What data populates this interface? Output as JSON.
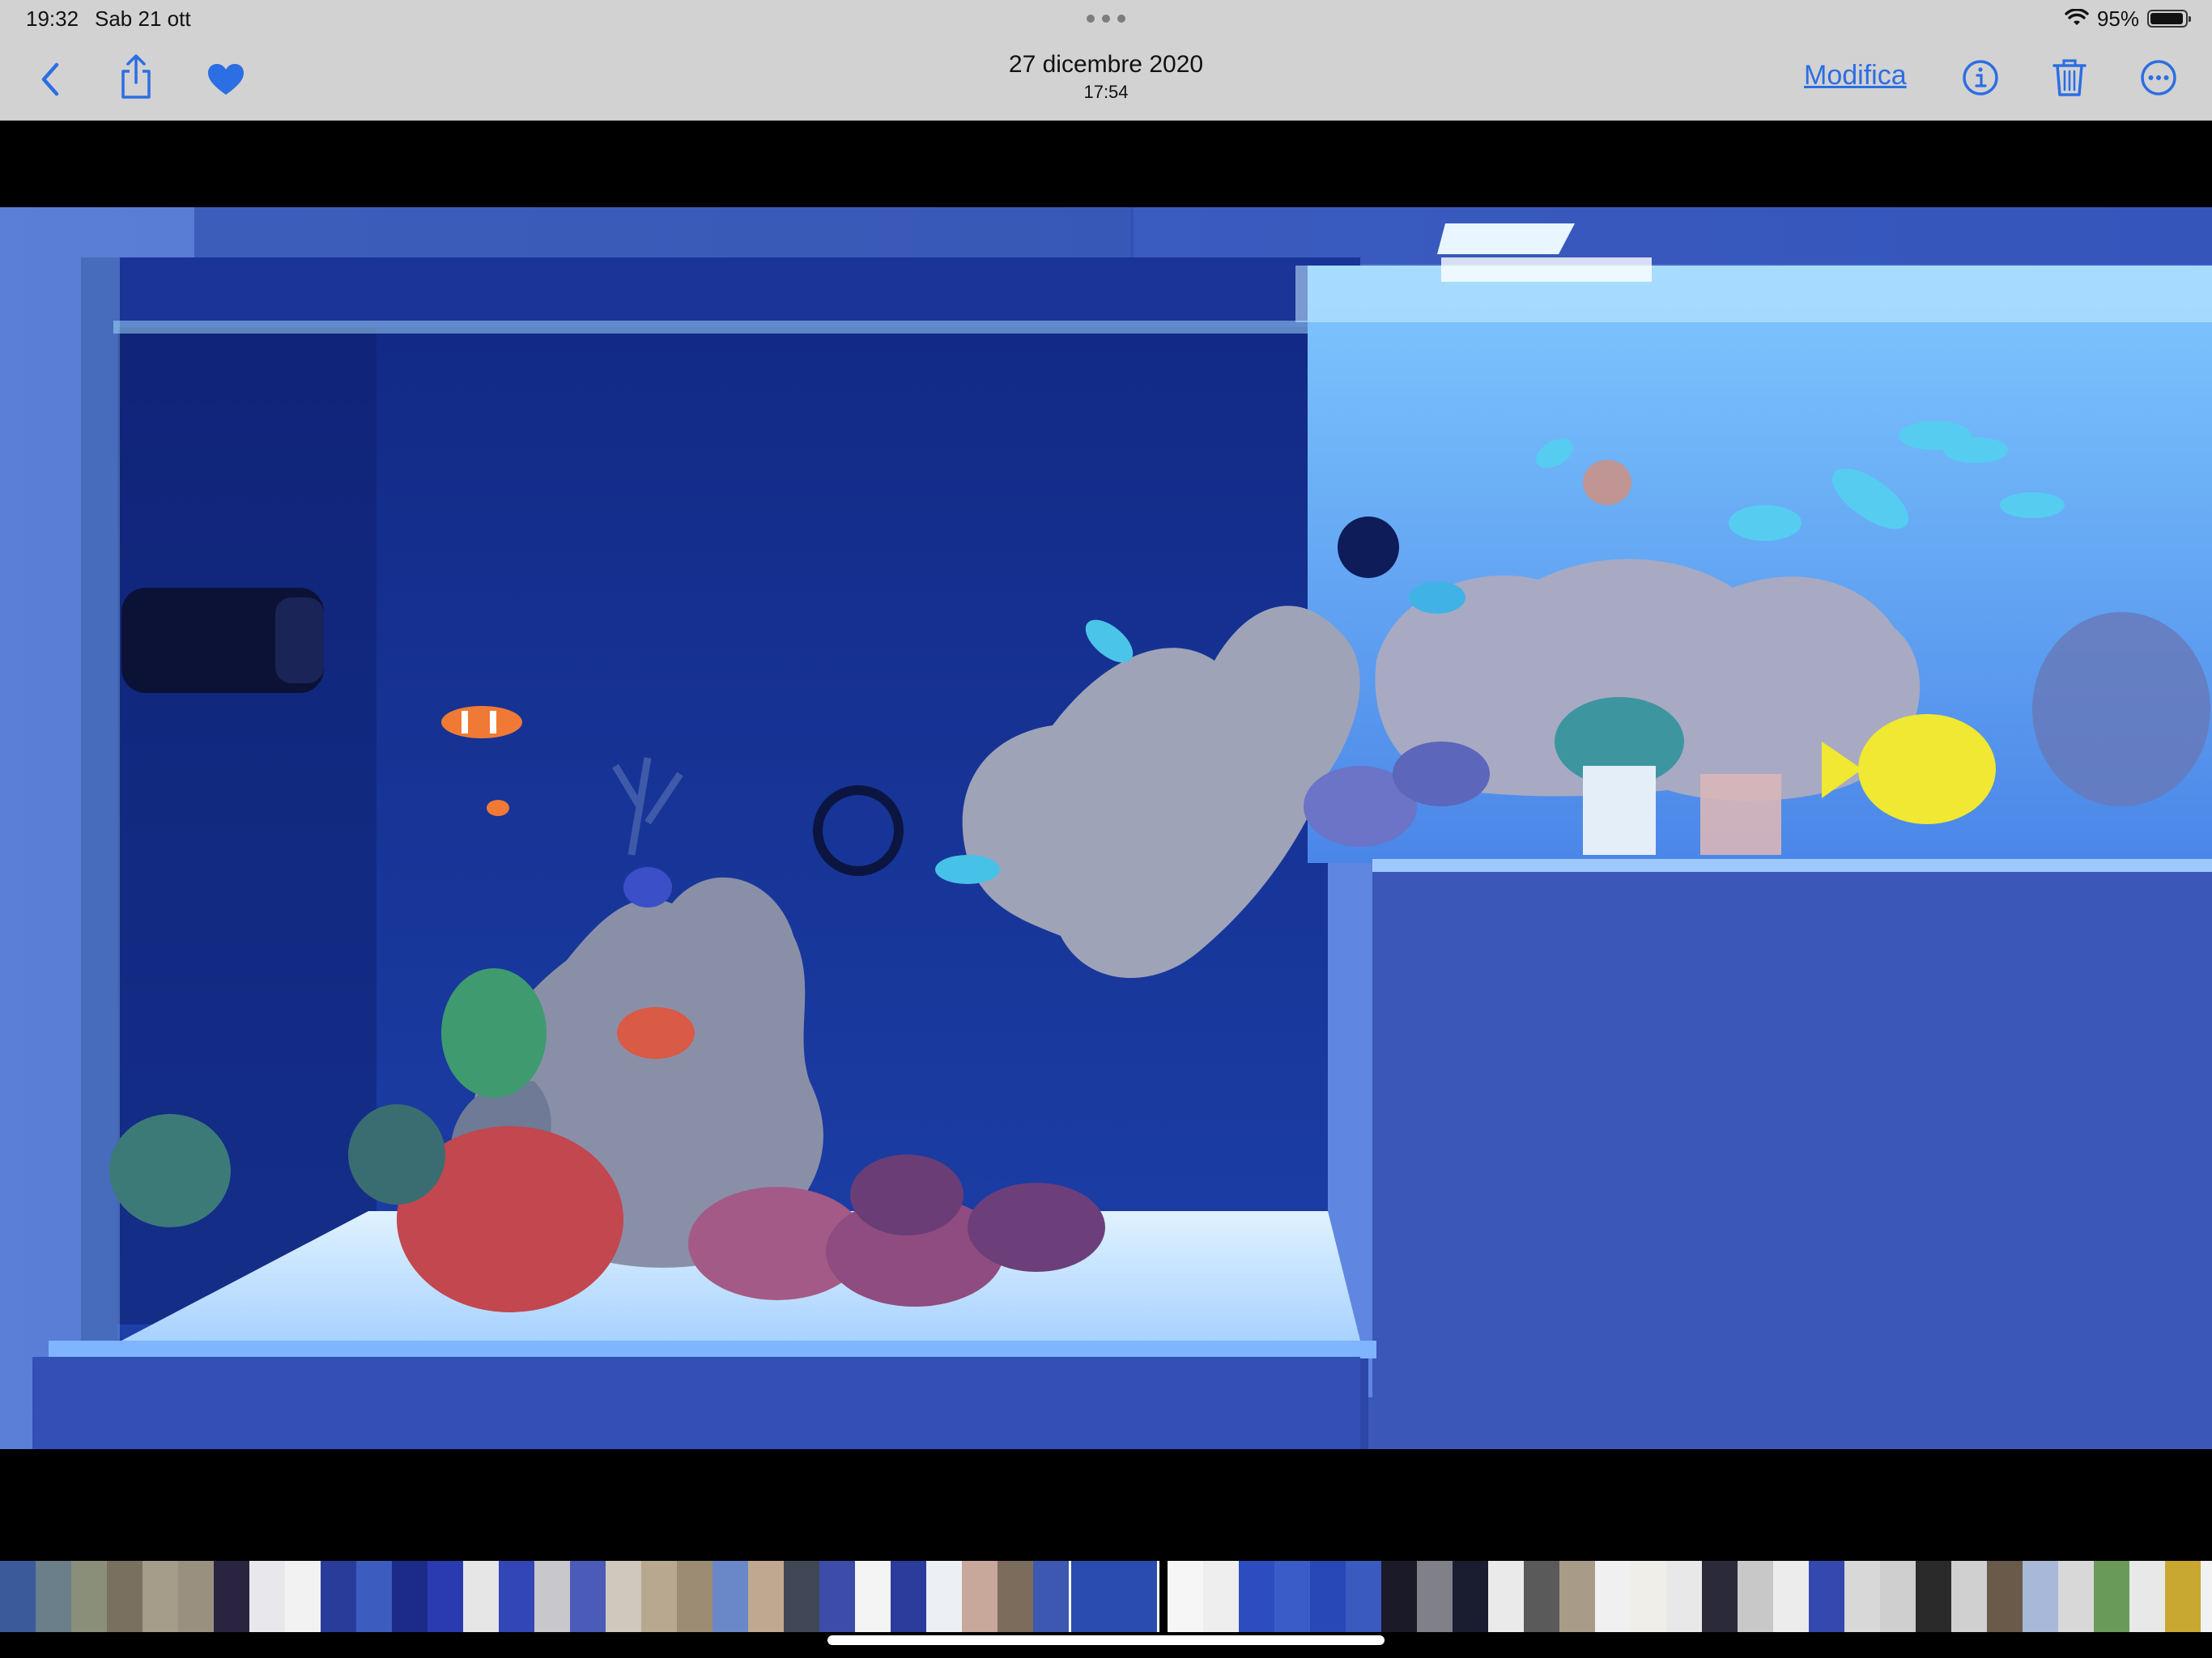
{
  "status_bar": {
    "time": "19:32",
    "date": "Sab 21 ott",
    "battery_percent": "95%",
    "battery_level": 0.95
  },
  "nav_bar": {
    "title_date": "27 dicembre 2020",
    "title_time": "17:54",
    "edit_label": "Modifica",
    "favorite": true,
    "accent_color": "#2c6ee3"
  },
  "photo": {
    "subject_icon": "aquarium-photo"
  },
  "thumbnail_strip": {
    "selected_index": 30,
    "thumbnails": [
      "#3b5a99",
      "#6b7f8a",
      "#8a8f7a",
      "#7a7060",
      "#a59c8a",
      "#9a9080",
      "#2a2440",
      "#e8e8ec",
      "#f2f2f2",
      "#2a3c9a",
      "#3c5cc0",
      "#1c2a88",
      "#2a3ab0",
      "#e6e6e6",
      "#3346b8",
      "#c8c8cc",
      "#4a5cb8",
      "#cfc8bc",
      "#b8a890",
      "#9c8c74",
      "#6a88c8",
      "#c0a890",
      "#404858",
      "#3c4ca8",
      "#f4f4f4",
      "#2c3c9c",
      "#eceff4",
      "#c8a89a",
      "#7c6c5c",
      "#3c58b0",
      "#2a4cb0",
      "#f6f6f6",
      "#eeeeee",
      "#2c4cc0",
      "#3a5cc8",
      "#2848b8",
      "#3a5ac0",
      "#1a1a28",
      "#808088",
      "#1a1c30",
      "#eaeaea",
      "#5a5a5a",
      "#a89c88",
      "#f0f0f0",
      "#f0eee8",
      "#e8e8e8",
      "#2a2a3a",
      "#c8c8c8",
      "#ececec",
      "#3448b0",
      "#d8d8d8",
      "#cfcfcf",
      "#2a2a2a",
      "#d0d0d0",
      "#6a5a4a",
      "#a8b8d8",
      "#d8d8d8",
      "#6a9a5a",
      "#e8e8e8",
      "#c8a830",
      "#f2f2f2",
      "#ececec"
    ]
  }
}
